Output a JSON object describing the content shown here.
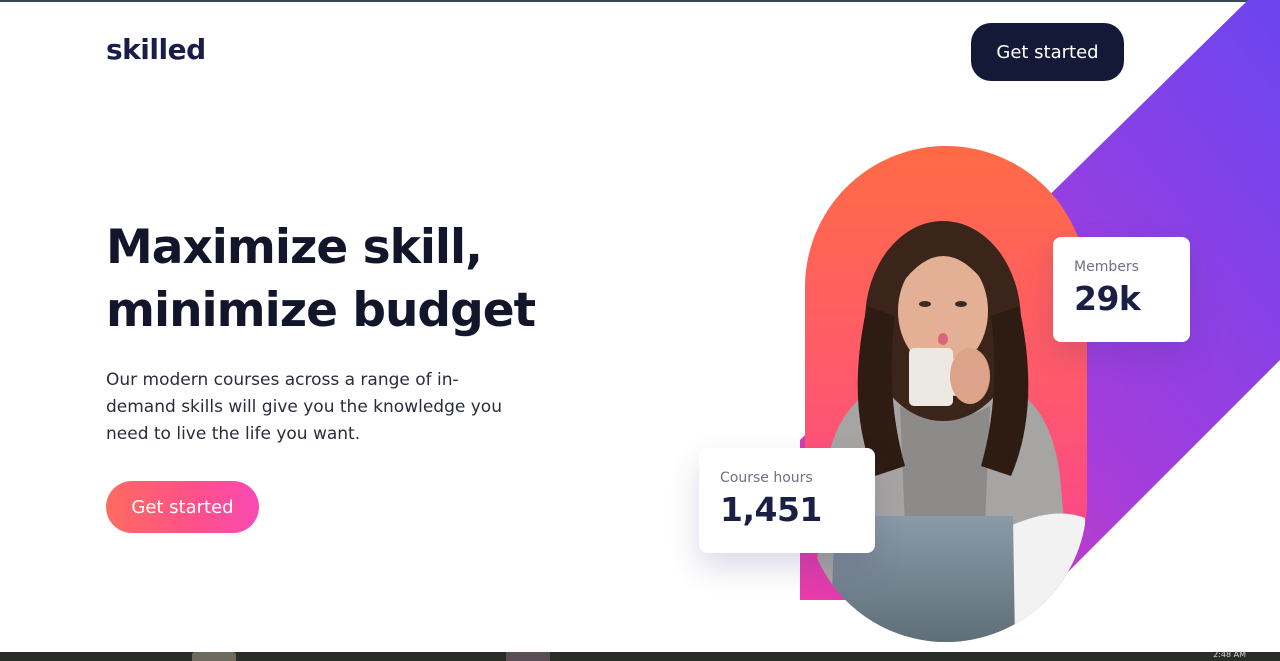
{
  "header": {
    "logo": "skilled",
    "cta_label": "Get started"
  },
  "hero": {
    "headline_line1": "Maximize skill,",
    "headline_line2": "minimize budget",
    "description": "Our modern courses across a range of in-demand skills will give you the knowledge you need to live the life you want.",
    "cta_label": "Get started",
    "image_icon": "woman-with-mug-photo"
  },
  "stats": {
    "members": {
      "label": "Members",
      "value": "29k"
    },
    "course_hours": {
      "label": "Course hours",
      "value": "1,451"
    }
  },
  "taskbar": {
    "clock": "2:48 AM"
  },
  "colors": {
    "navy": "#141938",
    "gradient_start": "#ff6b5f",
    "gradient_end": "#f84ab3",
    "purple": "#6b45f0"
  }
}
